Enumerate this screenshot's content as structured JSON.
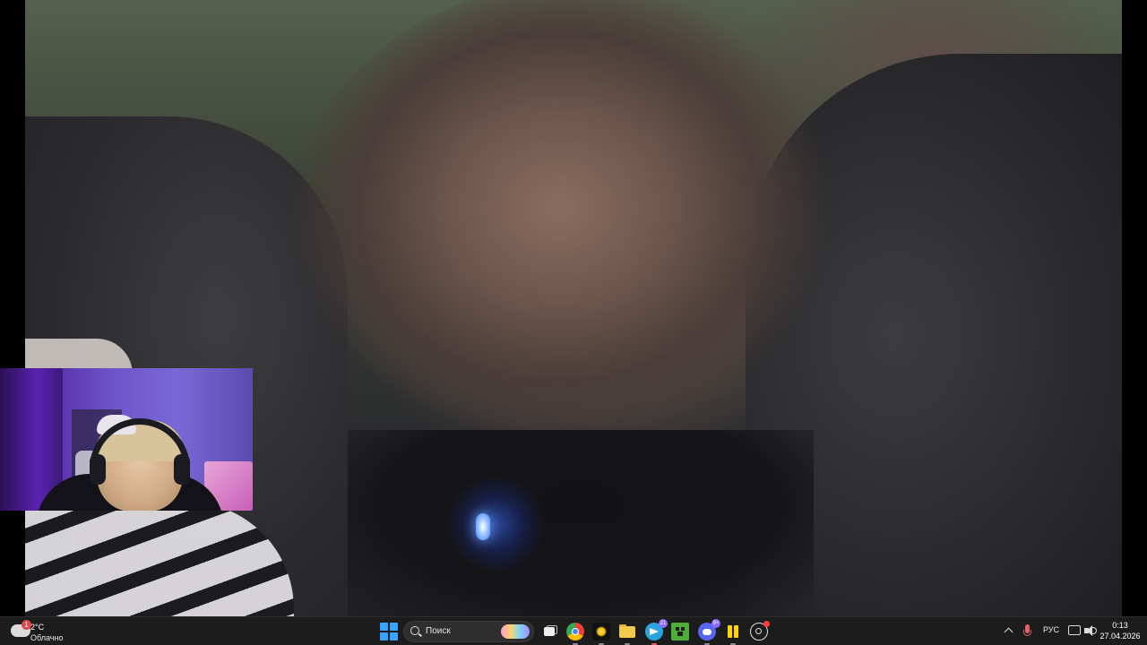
{
  "taskbar": {
    "weather": {
      "temperature": "2°C",
      "description": "Облачно",
      "badge": "1",
      "icon": "cloud-icon"
    },
    "search": {
      "label": "Поиск",
      "icon": "search-icon"
    },
    "apps": [
      {
        "name": "task-view",
        "icon": "task-view-icon"
      },
      {
        "name": "chrome",
        "icon": "chrome-icon",
        "badge": ""
      },
      {
        "name": "spark",
        "icon": "spark-icon"
      },
      {
        "name": "file-explorer",
        "icon": "folder-icon"
      },
      {
        "name": "telegram",
        "icon": "telegram-icon",
        "badge": "21"
      },
      {
        "name": "minecraft",
        "icon": "minecraft-icon"
      },
      {
        "name": "discord",
        "icon": "discord-icon",
        "badge": "9+"
      },
      {
        "name": "bolt",
        "icon": "bolt-icon"
      },
      {
        "name": "steam",
        "icon": "steam-icon"
      }
    ],
    "tray": {
      "language": "РУС",
      "time": "0:13",
      "date": "27.04.2026"
    }
  },
  "colors": {
    "taskbar_bg": "#1c1c1c",
    "start_accent": "#3aa3ff",
    "led_blue": "#3d7dff",
    "webcam_purple": "#6d55c9"
  }
}
